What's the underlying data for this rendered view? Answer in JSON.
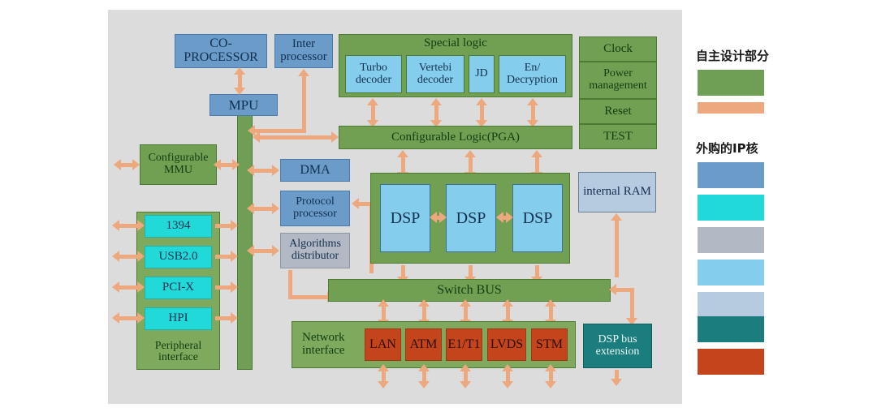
{
  "diagram": {
    "title": "SoC architecture block diagram",
    "canvas_color": "#dcdcdc",
    "arrow_color": "#eda87e"
  },
  "blocks": {
    "co_processor": "CO-PROCESSOR",
    "inter_processor": "Inter processor",
    "mpu": "MPU",
    "special_logic": "Special logic",
    "turbo_decoder": "Turbo decoder",
    "vertebi_decoder": "Vertebi decoder",
    "jd": "JD",
    "en_decryption": "En/ Decryption",
    "clock": "Clock",
    "power_management": "Power management",
    "reset": "Reset",
    "test": "TEST",
    "configurable_logic": "Configurable Logic(PGA)",
    "configurable_mmu": "Configurable MMU",
    "dma": "DMA",
    "protocol_processor": "Protocol processor",
    "algorithms_distributor": "Algorithms distributor",
    "dsp1": "DSP",
    "dsp2": "DSP",
    "dsp3": "DSP",
    "internal_ram": "internal RAM",
    "switch_bus": "Switch BUS",
    "peripheral_interface": "Peripheral interface",
    "p1394": "1394",
    "usb": "USB2.0",
    "pcix": "PCI-X",
    "hpi": "HPI",
    "network_interface": "Network interface",
    "lan": "LAN",
    "atm": "ATM",
    "e1t1": "E1/T1",
    "lvds": "LVDS",
    "stm": "STM",
    "dsp_bus_extension": "DSP bus extension"
  },
  "legend": {
    "group1_title": "自主设计部分",
    "group1_swatches": [
      {
        "name": "green-swatch",
        "color": "#6f9f54"
      },
      {
        "name": "peach-swatch",
        "color": "#eda87e"
      }
    ],
    "group2_title": "外购的IP核",
    "group2_swatches": [
      {
        "name": "steel-blue-swatch",
        "color": "#6a9bc9"
      },
      {
        "name": "cyan-swatch",
        "color": "#22d9d9"
      },
      {
        "name": "gray-swatch",
        "color": "#b3b9c4"
      },
      {
        "name": "light-blue-swatch",
        "color": "#85cdec"
      },
      {
        "name": "pale-blue-swatch",
        "color": "#b7cbe0"
      },
      {
        "name": "teal-swatch",
        "color": "#1b7d7d"
      },
      {
        "name": "rust-swatch",
        "color": "#c4441c"
      }
    ]
  }
}
